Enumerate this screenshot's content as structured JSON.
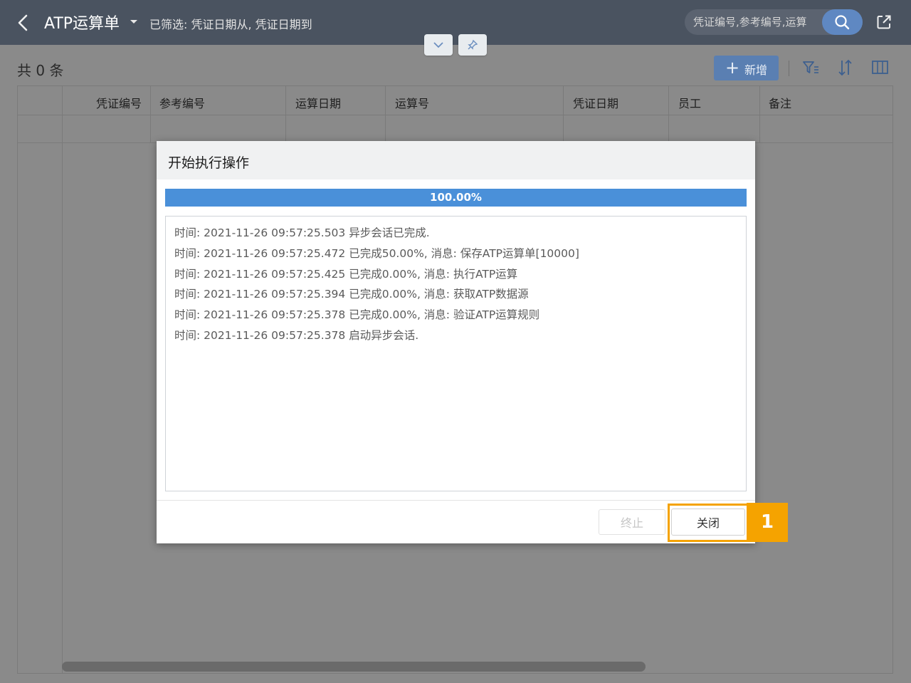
{
  "header": {
    "title": "ATP运算单",
    "filter_text": "已筛选: 凭证日期从, 凭证日期到",
    "search_placeholder": "凭证编号,参考编号,运算"
  },
  "toolbar": {
    "count_text": "共 0 条",
    "add_label": "新增"
  },
  "grid": {
    "columns": [
      "凭证编号",
      "参考编号",
      "运算日期",
      "运算号",
      "凭证日期",
      "员工",
      "备注"
    ]
  },
  "dialog": {
    "title": "开始执行操作",
    "progress": {
      "percent": 100,
      "label": "100.00%"
    },
    "log_lines": [
      "时间: 2021-11-26 09:57:25.503 异步会话已完成.",
      "时间: 2021-11-26 09:57:25.472 已完成50.00%, 消息: 保存ATP运算单[10000]",
      "时间: 2021-11-26 09:57:25.425 已完成0.00%, 消息: 执行ATP运算",
      "时间: 2021-11-26 09:57:25.394 已完成0.00%, 消息: 获取ATP数据源",
      "时间: 2021-11-26 09:57:25.378 已完成0.00%, 消息: 验证ATP运算规则",
      "时间: 2021-11-26 09:57:25.378 启动异步会话."
    ],
    "stop_label": "终止",
    "close_label": "关闭"
  },
  "callout": {
    "number": "1",
    "color": "#f5a300"
  },
  "colors": {
    "header": "#4a5360",
    "primary": "#4a90d9",
    "overlay": "#8a8a8a"
  }
}
